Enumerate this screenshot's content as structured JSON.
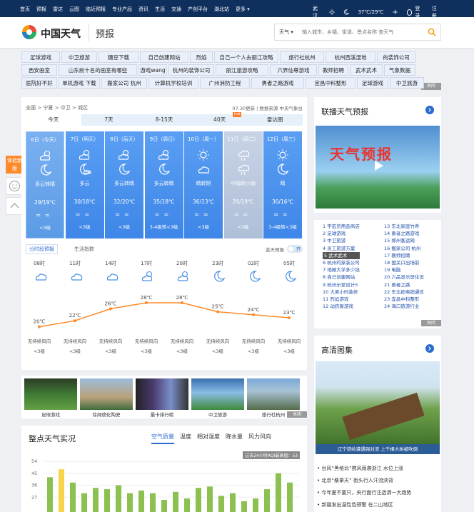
{
  "topbar": {
    "nav": [
      "首页",
      "预报",
      "雷达",
      "云图",
      "临近预报",
      "专业产品",
      "资讯",
      "生活",
      "交通",
      "产创平台",
      "湖北站",
      "更多"
    ],
    "city": "武汉",
    "temp": "37℃/29℃",
    "login": "登录",
    "register": "注册"
  },
  "header": {
    "brand": "中国天气",
    "section": "预报",
    "search_type": "天气",
    "search_placeholder": "输入城市、乡镇、街道、景点名称 查天气"
  },
  "ads": {
    "row1": [
      "足球游戏",
      "中卫旅游",
      "糖豆下载",
      "自己创建网站",
      "烈焰",
      "自己一个人去丽江攻略",
      "旅行社杭州",
      "杭州西溪湿地",
      "的装饰公司"
    ],
    "row2": [
      "西安画室",
      "山东前十名的画室有哪些",
      "游戏wang",
      "杭州的装饰公司",
      "丽江旅游攻略",
      "六界仙尊游戏",
      "教师招聘",
      "武术武术",
      "气象数据"
    ],
    "row3": [
      "医院好不好",
      "单机游戏 下载",
      "搬家公司 杭州",
      "计算机学校培训",
      "广州消防工程",
      "勇者之路游戏",
      "宜昌中科整形",
      "足球游戏",
      "中卫旅游"
    ],
    "close": "关闭"
  },
  "main": {
    "breadcrumb": "全国 > 宁夏 > 中卫 > 城区",
    "updated": "07:30更新 | 数据来源 中央气象台",
    "tabs": [
      "今天",
      "7天",
      "8-15天",
      "40天",
      "雷达图"
    ],
    "hot": "hot",
    "days": [
      {
        "date": "6日（今天）",
        "weather": "多云转晴",
        "temp": "29/19℃",
        "wind": "<3级",
        "icon1": "cloud-sun-icon",
        "icon2": "moon-icon"
      },
      {
        "date": "7日（明天）",
        "weather": "多云",
        "temp": "30/18℃",
        "wind": "<3级",
        "icon1": "cloud-sun-icon",
        "icon2": "moon-cloud-icon"
      },
      {
        "date": "8日（后天）",
        "weather": "多云转晴",
        "temp": "32/20℃",
        "wind": "<3级",
        "icon1": "cloud-sun-icon",
        "icon2": "moon-icon"
      },
      {
        "date": "9日（周日）",
        "weather": "多云转晴",
        "temp": "35/18℃",
        "wind": "3-4级转<3级",
        "icon1": "cloud-sun-icon",
        "icon2": "moon-icon"
      },
      {
        "date": "10日（周一）",
        "weather": "晴转阴",
        "temp": "36/13℃",
        "wind": "<3级",
        "icon1": "sun-icon",
        "icon2": "cloud-icon"
      },
      {
        "date": "11日（周二）",
        "weather": "中雨转小雨",
        "temp": "29/19℃",
        "wind": "<3级",
        "icon1": "rain-icon",
        "icon2": "rain-icon"
      },
      {
        "date": "12日（周三）",
        "weather": "晴",
        "temp": "30/16℃",
        "wind": "3-4级转<3级",
        "icon1": "sun-icon",
        "icon2": "moon-icon"
      }
    ],
    "subtab_hourly": "分时段预报",
    "subtab_index": "生活指数",
    "alert_label": "蓝天预报",
    "toggle": "开",
    "hours": [
      "08时",
      "11时",
      "14时",
      "17时",
      "20时",
      "23时",
      "02时",
      "05时"
    ],
    "hour_temps": [
      "20℃",
      "22℃",
      "26℃",
      "28℃",
      "28℃",
      "25℃",
      "24℃",
      "23℃"
    ],
    "hour_temp_values": [
      20,
      22,
      26,
      28,
      28,
      25,
      24,
      23
    ],
    "hour_wind": "无持续风向",
    "hour_wind_level": "<3级"
  },
  "thumbs": [
    {
      "caption": "足球游戏"
    },
    {
      "caption": "徐闻德化陶瓷"
    },
    {
      "caption": "最卡排行榜"
    },
    {
      "caption": "中卫旅游"
    },
    {
      "caption": "旅行社杭州"
    }
  ],
  "observation": {
    "title": "整点天气实况",
    "tabs": [
      "空气质量",
      "温度",
      "相对湿度",
      "降水量",
      "风力风向"
    ],
    "aqi_note": "过去24小时AQI最高值：53",
    "y_ticks": [
      "54",
      "45",
      "36",
      "27"
    ],
    "bar_values": [
      42,
      48,
      38,
      30,
      34,
      33,
      36,
      30,
      32,
      30,
      25,
      31,
      26,
      34,
      35,
      28,
      30,
      24,
      26,
      33,
      45,
      38
    ]
  },
  "right": {
    "video_title": "联播天气预报",
    "video_overlay": "天气预报",
    "adlist_left": [
      "1 宇宏货用品商店",
      "2 足球游戏",
      "3 中卫旅游",
      "4 员工旅游方案",
      "5 武术武术",
      "6 杭州的家装公司",
      "7 地摊大学多少钱",
      "8 自己创建网站",
      "9 杭州示至设计5",
      "10 大男小时装修",
      "11 烈焰游戏",
      "12 动药客游戏"
    ],
    "adlist_right": [
      "13 东北家庭竹养",
      "14 勇者之路游戏",
      "15 郑州客运网",
      "16 搬家公司 杭州",
      "17 教师招聘",
      "18 国关口出场前",
      "19 电脑",
      "20 六品显示屏化设",
      "21 勇者之路",
      "22 东北拓电销通信",
      "23 宜昌中科整形",
      "24 海口旅游行业"
    ],
    "adlist_close": "关闭",
    "gallery_title": "高清图集",
    "gallery_caption": "辽宁铁岭遭遇强对流 上千棵大树被吹倒",
    "news": [
      "台风“黑格比”携风雨袭浙江 水位上涨",
      "北京“桑拿天” 街头行人汗流浃背",
      "今年夏不要只，央行面行注选谓一大趋势",
      "新疆发出温性色预警 在二山地区"
    ]
  },
  "sidebar": {
    "feedback": "体验新版"
  },
  "colors": {
    "topbar": "#0f2f5d",
    "accent": "#2a6bd0",
    "orange": "#ff8a2a",
    "bar_green": "#8cc152",
    "bar_yellow": "#f5d547"
  }
}
